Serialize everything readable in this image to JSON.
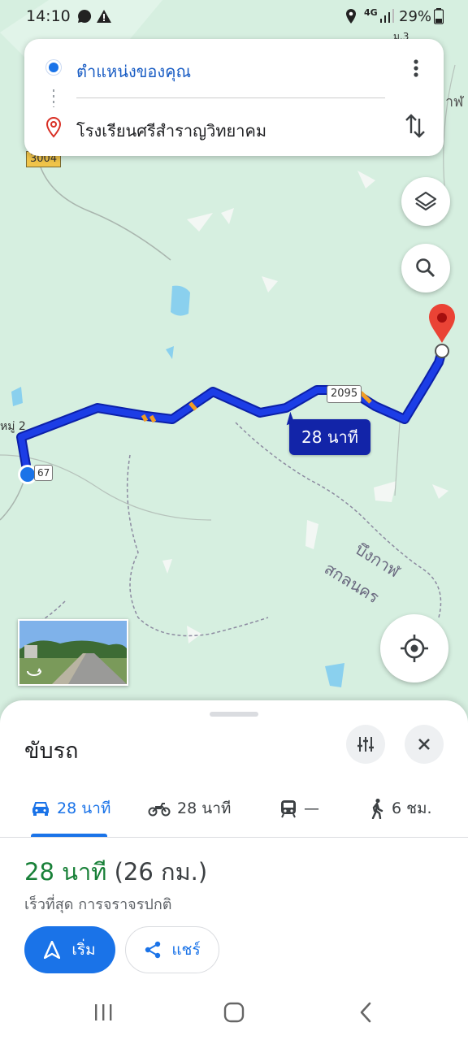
{
  "status_bar": {
    "time": "14:10",
    "network": "4G",
    "battery": "29%"
  },
  "route_card": {
    "origin": "ตำแหน่งของคุณ",
    "destination": "โรงเรียนศรีสำราญวิทยาคม"
  },
  "map": {
    "route_duration_label": "28 นาที",
    "road_shields": [
      "3004",
      "2095",
      "67"
    ],
    "place_labels": [
      "หมู่ 2",
      "บึงกาฬ",
      "สกลนคร",
      "ม.3",
      "าฬ"
    ],
    "route_color": "#1a3be8",
    "accent": "#1a73e8"
  },
  "sheet": {
    "title": "ขับรถ",
    "modes": [
      {
        "name": "car",
        "label": "28 นาที"
      },
      {
        "name": "motorcycle",
        "label": "28 นาที"
      },
      {
        "name": "transit",
        "label": "—"
      },
      {
        "name": "walk",
        "label": "6 ชม."
      }
    ],
    "duration": "28 นาที",
    "distance": "(26 กม.)",
    "subtitle": "เร็วที่สุด การจราจรปกติ",
    "start_label": "เริ่ม",
    "share_label": "แชร์"
  }
}
